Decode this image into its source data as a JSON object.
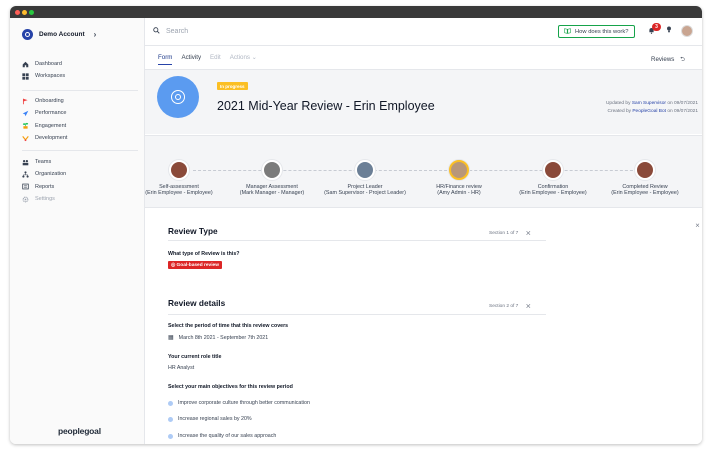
{
  "sidebar": {
    "account_name": "Demo Account",
    "groups": [
      [
        {
          "label": "Dashboard",
          "icon": "home-icon",
          "color": "#374151"
        },
        {
          "label": "Workspaces",
          "icon": "grid-icon",
          "color": "#374151"
        }
      ],
      [
        {
          "label": "Onboarding",
          "icon": "flag-icon",
          "color": "#ef4444"
        },
        {
          "label": "Performance",
          "icon": "rocket-icon",
          "color": "#3b82f6"
        },
        {
          "label": "Engagement",
          "icon": "plant-icon",
          "color": "#22c55e"
        },
        {
          "label": "Development",
          "icon": "growth-icon",
          "color": "#f59e0b"
        }
      ],
      [
        {
          "label": "Teams",
          "icon": "teams-icon",
          "color": "#374151"
        },
        {
          "label": "Organization",
          "icon": "org-icon",
          "color": "#374151"
        },
        {
          "label": "Reports",
          "icon": "reports-icon",
          "color": "#374151"
        },
        {
          "label": "Settings",
          "icon": "gear-icon",
          "color": "#9ca3af"
        }
      ]
    ],
    "brand": "peoplegoal"
  },
  "topbar": {
    "search_placeholder": "Search",
    "how_button": "How does this work?",
    "notification_count": "3"
  },
  "tabs": [
    {
      "label": "Form",
      "state": "active"
    },
    {
      "label": "Activity",
      "state": "normal"
    },
    {
      "label": "Edit",
      "state": "disabled"
    },
    {
      "label": "Actions",
      "state": "disabled"
    }
  ],
  "reviews_link": "Reviews",
  "review": {
    "status": "In progress",
    "title": "2021 Mid-Year Review - Erin Employee",
    "updated_prefix": "Updated by",
    "updated_by": "Sam Supervisor",
    "updated_on": "on 09/07/2021",
    "created_prefix": "Created by",
    "created_by": "PeopleGoal Bot",
    "created_on": "on 09/07/2021"
  },
  "steps": [
    {
      "label1": "Self-assessment",
      "label2": "(Erin Employee - Employee)",
      "avatar": "#8a4a3a",
      "current": false
    },
    {
      "label1": "Manager Assessment",
      "label2": "(Mark Manager - Manager)",
      "avatar": "#7b7b7b",
      "current": false
    },
    {
      "label1": "Project Leader",
      "label2": "(Sam Supervisor - Project Leader)",
      "avatar": "#6b7f96",
      "current": false
    },
    {
      "label1": "HR/Finance review",
      "label2": "(Amy Admin - HR)",
      "avatar": "#b8977a",
      "current": true
    },
    {
      "label1": "Confirmation",
      "label2": "(Erin Employee - Employee)",
      "avatar": "#8a4a3a",
      "current": false
    },
    {
      "label1": "Completed Review",
      "label2": "(Erin Employee - Employee)",
      "avatar": "#8a4a3a",
      "current": false
    }
  ],
  "sections": {
    "review_type": {
      "title": "Review Type",
      "meta": "Section 1 of 7",
      "question": "What type of Review is this?",
      "answer_tag": "Goal-based review"
    },
    "details": {
      "title": "Review details",
      "meta": "Section 2 of 7",
      "q_period": "Select the period of time that this review covers",
      "a_period": "March 8th 2021 - September 7th 2021",
      "q_role": "Your current role title",
      "a_role": "HR Analyst",
      "q_objectives": "Select your main objectives for this review period",
      "objectives": [
        "Improve corporate culture through better communication",
        "Increase regional sales by 20%",
        "Increase the quality of our sales approach"
      ]
    }
  }
}
